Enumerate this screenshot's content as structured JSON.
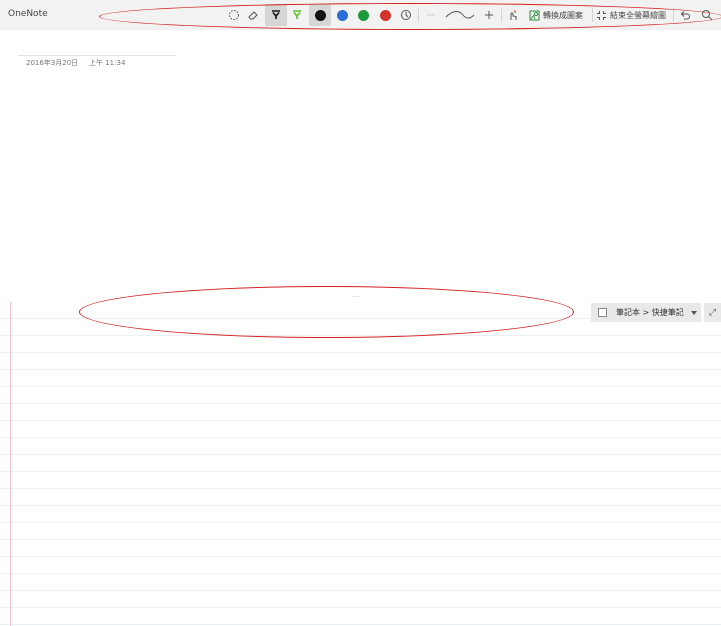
{
  "app": {
    "title": "OneNote"
  },
  "toolbar": {
    "convert_to_shapes_label": "轉換成圖案",
    "exit_fullscreen_label": "結束全螢幕繪圖",
    "colors": {
      "black": "#111111",
      "blue": "#2b6fd6",
      "green": "#1f9a3a",
      "red": "#d2342b",
      "highlighter": "#5bbf2a",
      "selected_bg": "#d6d6d6"
    },
    "icons": [
      "lasso-select-icon",
      "eraser-icon",
      "pen-icon",
      "highlighter-icon",
      "ink-color-black",
      "ink-color-blue",
      "ink-color-green",
      "ink-color-red",
      "color-picker-icon",
      "thickness-curve-icon",
      "add-icon",
      "touch-draw-icon",
      "convert-to-shapes-icon",
      "exit-fullscreen-icon",
      "undo-icon",
      "search-icon"
    ]
  },
  "page": {
    "date": "2016年3月20日",
    "time": "上午 11:34"
  },
  "notebook": {
    "path": "筆記本 > 快捷筆記",
    "expand_glyph": "⤢"
  },
  "annotation_color": "#d42020"
}
